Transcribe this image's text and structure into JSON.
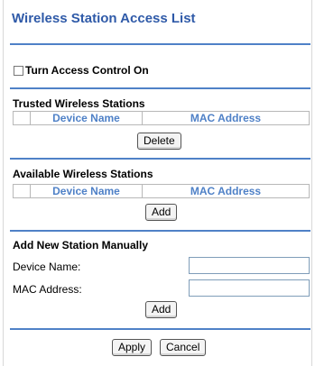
{
  "page": {
    "title": "Wireless Station Access List"
  },
  "access_control": {
    "label": "Turn Access Control On",
    "checked": false
  },
  "trusted": {
    "heading": "Trusted Wireless Stations",
    "columns": [
      "",
      "Device Name",
      "MAC Address"
    ],
    "button": "Delete"
  },
  "available": {
    "heading": "Available Wireless Stations",
    "columns": [
      "",
      "Device Name",
      "MAC Address"
    ],
    "button": "Add"
  },
  "manual": {
    "heading": "Add New Station Manually",
    "device_label": "Device Name:",
    "device_value": "",
    "mac_label": "MAC Address:",
    "mac_value": "",
    "button": "Add"
  },
  "footer": {
    "apply": "Apply",
    "cancel": "Cancel"
  },
  "colors": {
    "accent": "#2f5aa8",
    "rule": "#4f81c7",
    "header_text": "#4f81c7"
  }
}
